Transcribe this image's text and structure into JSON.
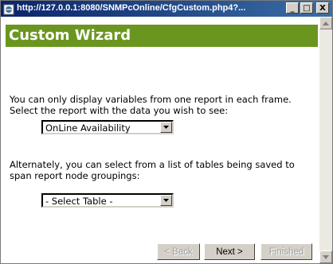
{
  "window": {
    "title": "http://127.0.0.1:8080/SNMPcOnline/CfgCustom.php4?...",
    "icon": "ie-page-icon",
    "controls": {
      "minimize": "_",
      "maximize": "□",
      "close": "X"
    }
  },
  "wizard": {
    "heading": "Custom Wizard",
    "intro_text": "You can only display variables from one report in each frame. Select the report with the data you wish to see:",
    "report_select": {
      "selected": "OnLine Availability"
    },
    "alt_text": "Alternately, you can select from a list of tables being saved to span report node groupings:",
    "table_select": {
      "selected": "- Select Table -"
    }
  },
  "buttons": {
    "back": "< Back",
    "next": "Next >",
    "finished": "Finished"
  },
  "colors": {
    "header_bg": "#6a961f",
    "titlebar": "#0a246a"
  }
}
